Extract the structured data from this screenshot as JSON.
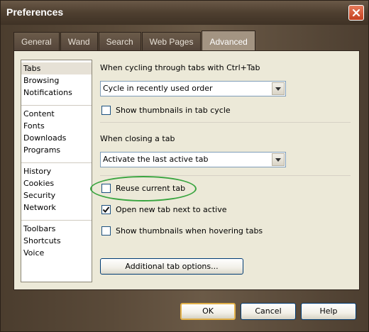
{
  "window": {
    "title": "Preferences"
  },
  "tabs": [
    {
      "label": "General"
    },
    {
      "label": "Wand"
    },
    {
      "label": "Search"
    },
    {
      "label": "Web Pages"
    },
    {
      "label": "Advanced",
      "active": true
    }
  ],
  "sidebar": {
    "groups": [
      [
        "Tabs",
        "Browsing",
        "Notifications"
      ],
      [
        "Content",
        "Fonts",
        "Downloads",
        "Programs"
      ],
      [
        "History",
        "Cookies",
        "Security",
        "Network"
      ],
      [
        "Toolbars",
        "Shortcuts",
        "Voice"
      ]
    ],
    "selected": "Tabs"
  },
  "tabs_settings": {
    "cycling_label": "When cycling through tabs with Ctrl+Tab",
    "cycling_value": "Cycle in recently used order",
    "show_thumbnails_cycle": {
      "label": "Show thumbnails in tab cycle",
      "checked": false
    },
    "closing_label": "When closing a tab",
    "closing_value": "Activate the last active tab",
    "reuse_current_tab": {
      "label": "Reuse current tab",
      "checked": false
    },
    "open_new_tab_next": {
      "label": "Open new tab next to active",
      "checked": true
    },
    "show_thumbnails_hover": {
      "label": "Show thumbnails when hovering tabs",
      "checked": false
    },
    "additional_button": "Additional tab options..."
  },
  "footer": {
    "ok": "OK",
    "cancel": "Cancel",
    "help": "Help"
  },
  "colors": {
    "highlight": "#3aa540",
    "accent": "#003c74"
  }
}
